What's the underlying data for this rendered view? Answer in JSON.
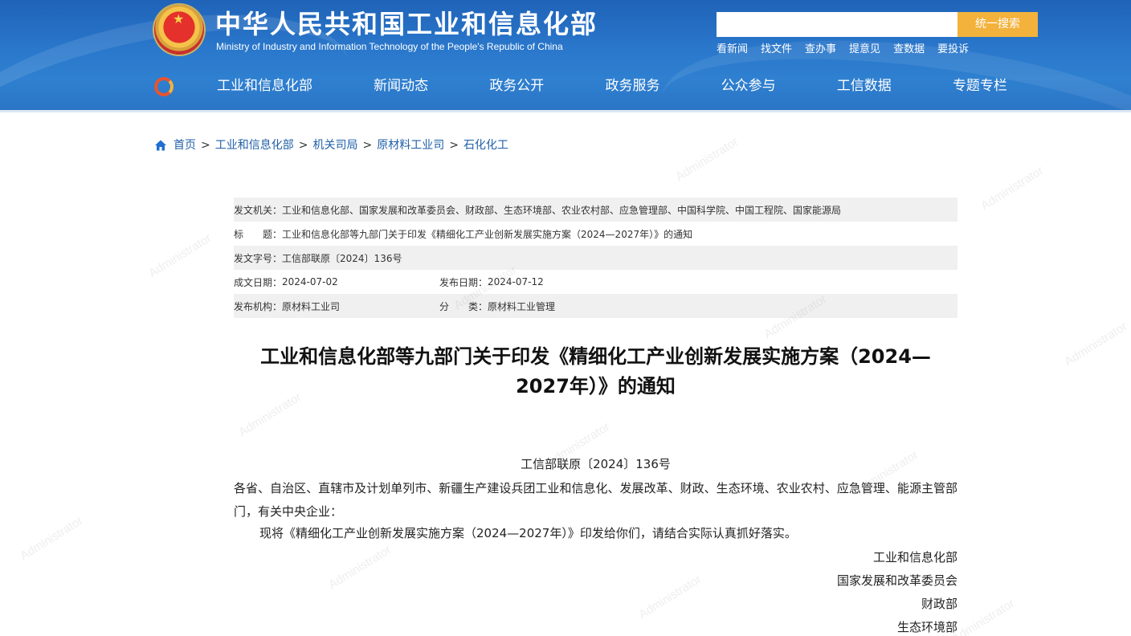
{
  "header": {
    "title_cn": "中华人民共和国工业和信息化部",
    "title_en": "Ministry of Industry and Information Technology of the People's Republic of China",
    "search_placeholder": "",
    "search_button": "统一搜索",
    "quick_links": [
      "看新闻",
      "找文件",
      "查办事",
      "提意见",
      "查数据",
      "要投诉"
    ],
    "nav": [
      "工业和信息化部",
      "新闻动态",
      "政务公开",
      "政务服务",
      "公众参与",
      "工信数据",
      "专题专栏"
    ],
    "emblem_icon": "national-emblem-icon",
    "nav_logo_icon": "miit-logo-icon"
  },
  "breadcrumb": {
    "home_icon": "home-icon",
    "items": [
      "首页",
      "工业和信息化部",
      "机关司局",
      "原材料工业司",
      "石化化工"
    ],
    "separator": ">"
  },
  "meta": {
    "issuer_label": "发文机关：",
    "issuer_value": "工业和信息化部、国家发展和改革委员会、财政部、生态环境部、农业农村部、应急管理部、中国科学院、中国工程院、国家能源局",
    "title_label": "标　　题：",
    "title_value": "工业和信息化部等九部门关于印发《精细化工产业创新发展实施方案（2024—2027年）》的通知",
    "docno_label": "发文字号：",
    "docno_value": "工信部联原〔2024〕136号",
    "created_label": "成文日期：",
    "created_value": "2024-07-02",
    "published_label": "发布日期：",
    "published_value": "2024-07-12",
    "org_label": "发布机构：",
    "org_value": "原材料工业司",
    "category_label": "分　　类：",
    "category_value": "原材料工业管理"
  },
  "article": {
    "title": "工业和信息化部等九部门关于印发《精细化工产业创新发展实施方案（2024—2027年）》的通知",
    "doc_number": "工信部联原〔2024〕136号",
    "recipients": "各省、自治区、直辖市及计划单列市、新疆生产建设兵团工业和信息化、发展改革、财政、生态环境、农业农村、应急管理、能源主管部门，有关中央企业：",
    "body": "现将《精细化工产业创新发展实施方案（2024—2027年）》印发给你们，请结合实际认真抓好落实。",
    "signers": [
      "工业和信息化部",
      "国家发展和改革委员会",
      "财政部",
      "生态环境部"
    ]
  },
  "watermark": "Administrator",
  "colors": {
    "header_blue": "#2a78cc",
    "search_button": "#f3b23b",
    "link_blue": "#1f5fa8",
    "meta_shade": "#f0f0f0"
  }
}
